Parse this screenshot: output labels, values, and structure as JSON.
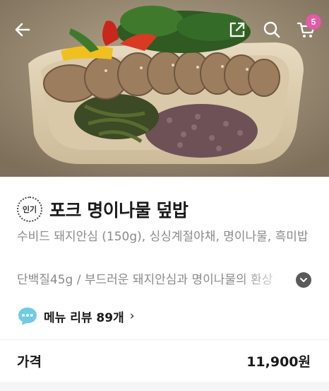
{
  "header": {
    "cart_count": "5",
    "icons": [
      "back-arrow-icon",
      "share-icon",
      "search-icon",
      "cart-icon"
    ]
  },
  "product": {
    "badge": "인기",
    "title": "포크 명이나물 덮밥",
    "description": "수비드 돼지안심 (150g), 싱싱계절야채, 명이나물, 흑미밥",
    "nutrition": "단백질45g /  부드러운 돼지안심과 명이나물의 환상",
    "review_label": "메뉴 리뷰 89개",
    "review_chevron": "›",
    "price_label": "가격",
    "price_value": "11,900원"
  },
  "colors": {
    "badge_pink": "#e25aa8",
    "text_dark": "#1a1a1a",
    "text_muted": "#8a8a8a"
  }
}
